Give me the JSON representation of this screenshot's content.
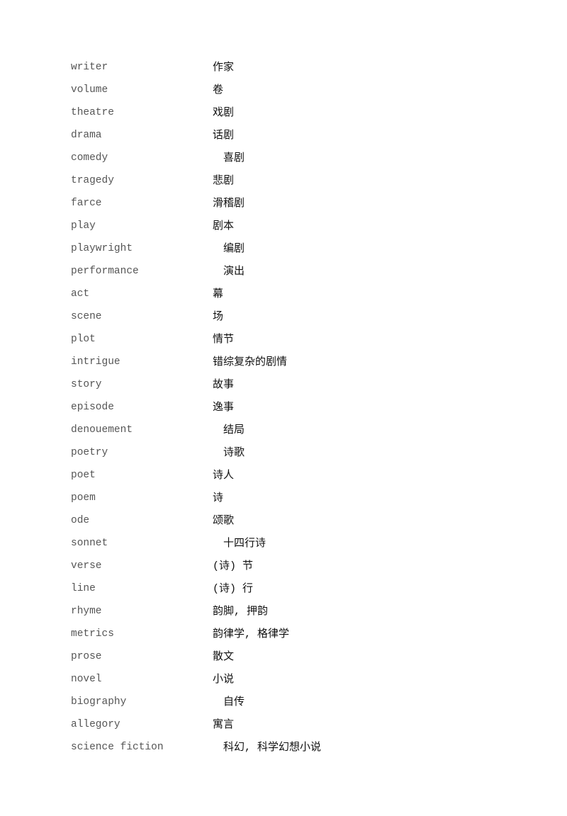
{
  "vocab": [
    {
      "en": "writer",
      "zh": "作家"
    },
    {
      "en": "volume",
      "zh": "卷"
    },
    {
      "en": "theatre",
      "zh": "戏剧"
    },
    {
      "en": "drama",
      "zh": "话剧"
    },
    {
      "en": "comedy",
      "zh": "　喜剧"
    },
    {
      "en": "tragedy",
      "zh": "悲剧"
    },
    {
      "en": "farce",
      "zh": "滑稽剧"
    },
    {
      "en": "play",
      "zh": "剧本"
    },
    {
      "en": "playwright",
      "zh": "　编剧"
    },
    {
      "en": "performance",
      "zh": "　演出"
    },
    {
      "en": "act",
      "zh": "幕"
    },
    {
      "en": "scene",
      "zh": "场"
    },
    {
      "en": "plot",
      "zh": "情节"
    },
    {
      "en": "intrigue",
      "zh": "错综复杂的剧情"
    },
    {
      "en": "story",
      "zh": "故事"
    },
    {
      "en": "episode",
      "zh": "逸事"
    },
    {
      "en": "denouement",
      "zh": "　结局"
    },
    {
      "en": "poetry",
      "zh": "　诗歌"
    },
    {
      "en": "poet",
      "zh": "诗人"
    },
    {
      "en": "poem",
      "zh": "诗"
    },
    {
      "en": "ode",
      "zh": "颂歌"
    },
    {
      "en": "sonnet",
      "zh": "　十四行诗"
    },
    {
      "en": "verse",
      "zh": "(诗) 节"
    },
    {
      "en": "line",
      "zh": "(诗) 行"
    },
    {
      "en": "rhyme",
      "zh": "韵脚, 押韵"
    },
    {
      "en": "metrics",
      "zh": "韵律学, 格律学"
    },
    {
      "en": "prose",
      "zh": "散文"
    },
    {
      "en": "novel",
      "zh": "小说"
    },
    {
      "en": "biography",
      "zh": "　自传"
    },
    {
      "en": "allegory",
      "zh": "寓言"
    },
    {
      "en": "science fiction",
      "zh": "　科幻, 科学幻想小说"
    }
  ]
}
